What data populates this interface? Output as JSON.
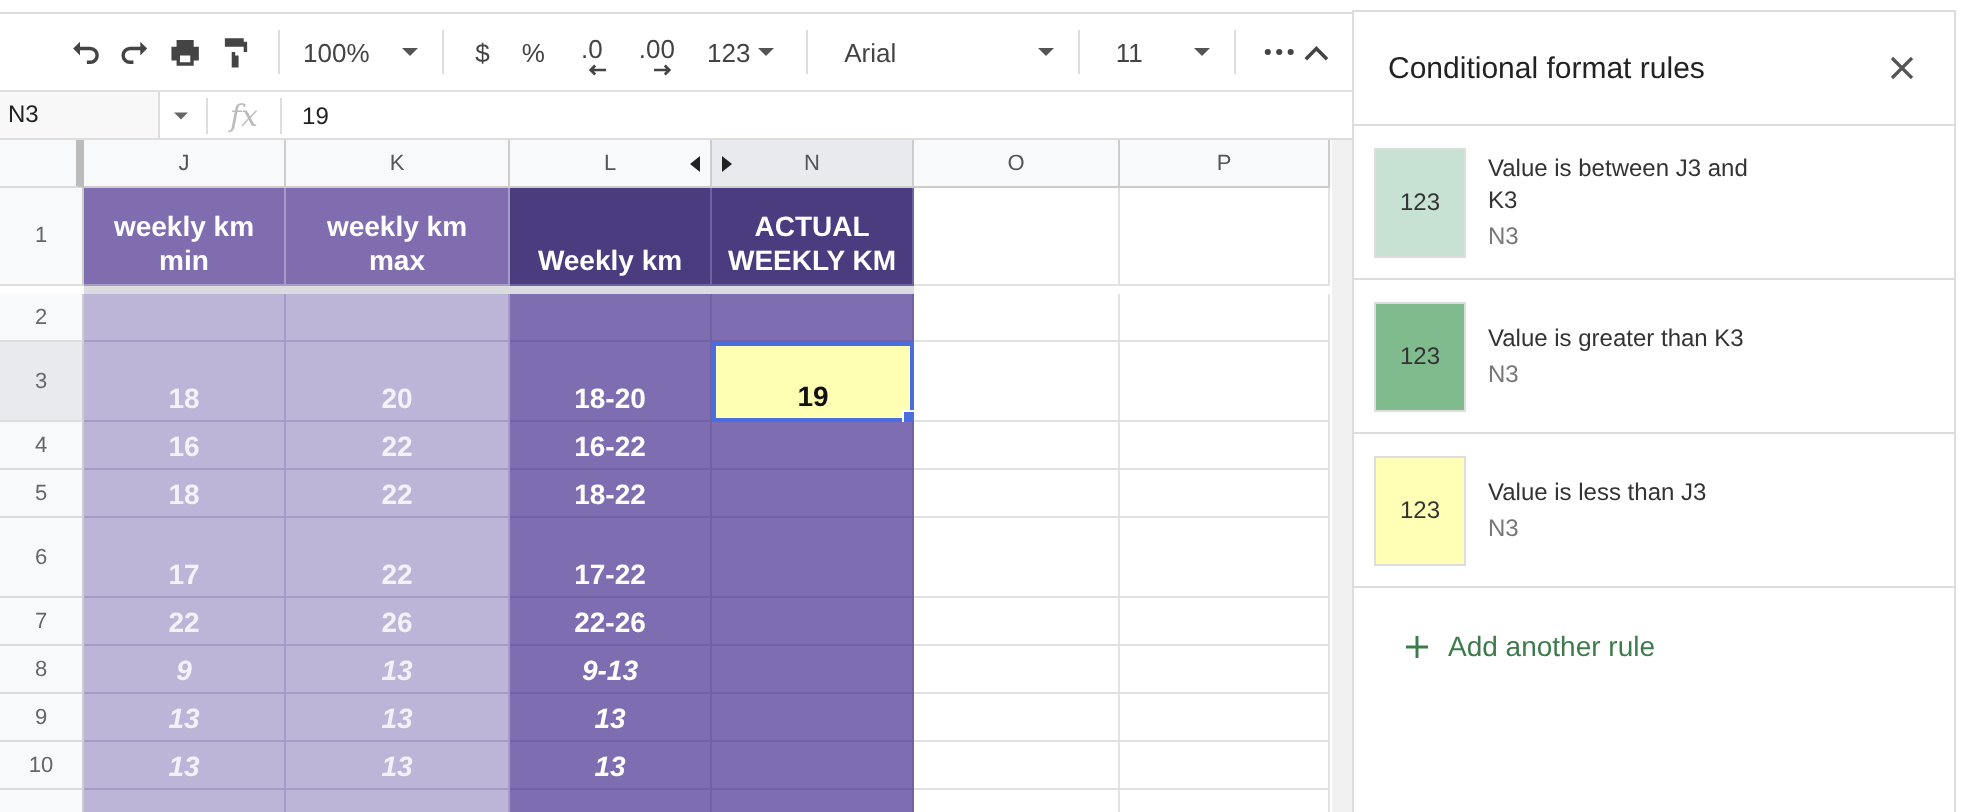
{
  "toolbar": {
    "zoom": "100%",
    "currency": "$",
    "percent": "%",
    "decrease_decimals": ".0",
    "increase_decimals": ".00",
    "number_format": "123",
    "font": "Arial",
    "font_size": "11"
  },
  "formula_bar": {
    "cell_ref": "N3",
    "fx_label": "fx",
    "value": "19"
  },
  "columns": [
    {
      "label": "J",
      "kind": "light",
      "selected": false
    },
    {
      "label": "K",
      "kind": "light",
      "selected": false
    },
    {
      "label": "L",
      "kind": "dark",
      "selected": false
    },
    {
      "label": "N",
      "kind": "dark",
      "selected": true
    },
    {
      "label": "O",
      "kind": "plain",
      "selected": false
    },
    {
      "label": "P",
      "kind": "plain",
      "selected": false
    }
  ],
  "header_row": {
    "number": "1",
    "cells": [
      "weekly km min",
      "weekly km max",
      "Weekly km",
      "ACTUAL WEEKLY KM"
    ]
  },
  "rows": [
    {
      "number": "2",
      "selected": false,
      "tall": false,
      "cells": [
        {
          "selected": false
        },
        {
          "selected": false
        },
        {
          "selected": false
        },
        {
          "selected": false
        }
      ]
    },
    {
      "number": "3",
      "selected": true,
      "tall": true,
      "italic": false,
      "cells": [
        {
          "text": "18",
          "selected": false
        },
        {
          "text": "20",
          "selected": false
        },
        {
          "text": "18-20",
          "selected": false
        },
        {
          "text": "19",
          "selected": true,
          "color": "#ffffb3"
        }
      ]
    },
    {
      "number": "4",
      "selected": false,
      "tall": false,
      "italic": false,
      "cells": [
        {
          "text": "16",
          "selected": false
        },
        {
          "text": "22",
          "selected": false
        },
        {
          "text": "16-22",
          "selected": false
        },
        {
          "selected": false
        }
      ]
    },
    {
      "number": "5",
      "selected": false,
      "tall": false,
      "italic": false,
      "cells": [
        {
          "text": "18",
          "selected": false
        },
        {
          "text": "22",
          "selected": false
        },
        {
          "text": "18-22",
          "selected": false
        },
        {
          "selected": false
        }
      ]
    },
    {
      "number": "6",
      "selected": false,
      "tall": true,
      "italic": false,
      "cells": [
        {
          "text": "17",
          "selected": false
        },
        {
          "text": "22",
          "selected": false
        },
        {
          "text": "17-22",
          "selected": false
        },
        {
          "selected": false
        }
      ]
    },
    {
      "number": "7",
      "selected": false,
      "tall": false,
      "italic": false,
      "cells": [
        {
          "text": "22",
          "selected": false
        },
        {
          "text": "26",
          "selected": false
        },
        {
          "text": "22-26",
          "selected": false
        },
        {
          "selected": false
        }
      ]
    },
    {
      "number": "8",
      "selected": false,
      "tall": false,
      "italic": true,
      "cells": [
        {
          "text": "9",
          "selected": false
        },
        {
          "text": "13",
          "selected": false
        },
        {
          "text": "9-13",
          "selected": false
        },
        {
          "selected": false
        }
      ]
    },
    {
      "number": "9",
      "selected": false,
      "tall": false,
      "italic": true,
      "cells": [
        {
          "text": "13",
          "selected": false
        },
        {
          "text": "13",
          "selected": false
        },
        {
          "text": "13",
          "selected": false
        },
        {
          "selected": false
        }
      ]
    },
    {
      "number": "10",
      "selected": false,
      "tall": false,
      "italic": true,
      "cells": [
        {
          "text": "13",
          "selected": false
        },
        {
          "text": "13",
          "selected": false
        },
        {
          "text": "13",
          "selected": false
        },
        {
          "selected": false
        }
      ]
    }
  ],
  "panel": {
    "title": "Conditional format rules",
    "rules": [
      {
        "sample": "123",
        "condition": "Value is between J3 and K3",
        "range": "N3",
        "color": "#c7e1d3"
      },
      {
        "sample": "123",
        "condition": "Value is greater than K3",
        "range": "N3",
        "color": "#7fbb8c"
      },
      {
        "sample": "123",
        "condition": "Value is less than J3",
        "range": "N3",
        "color": "#ffffb5"
      }
    ],
    "add_rule": "Add another rule"
  }
}
